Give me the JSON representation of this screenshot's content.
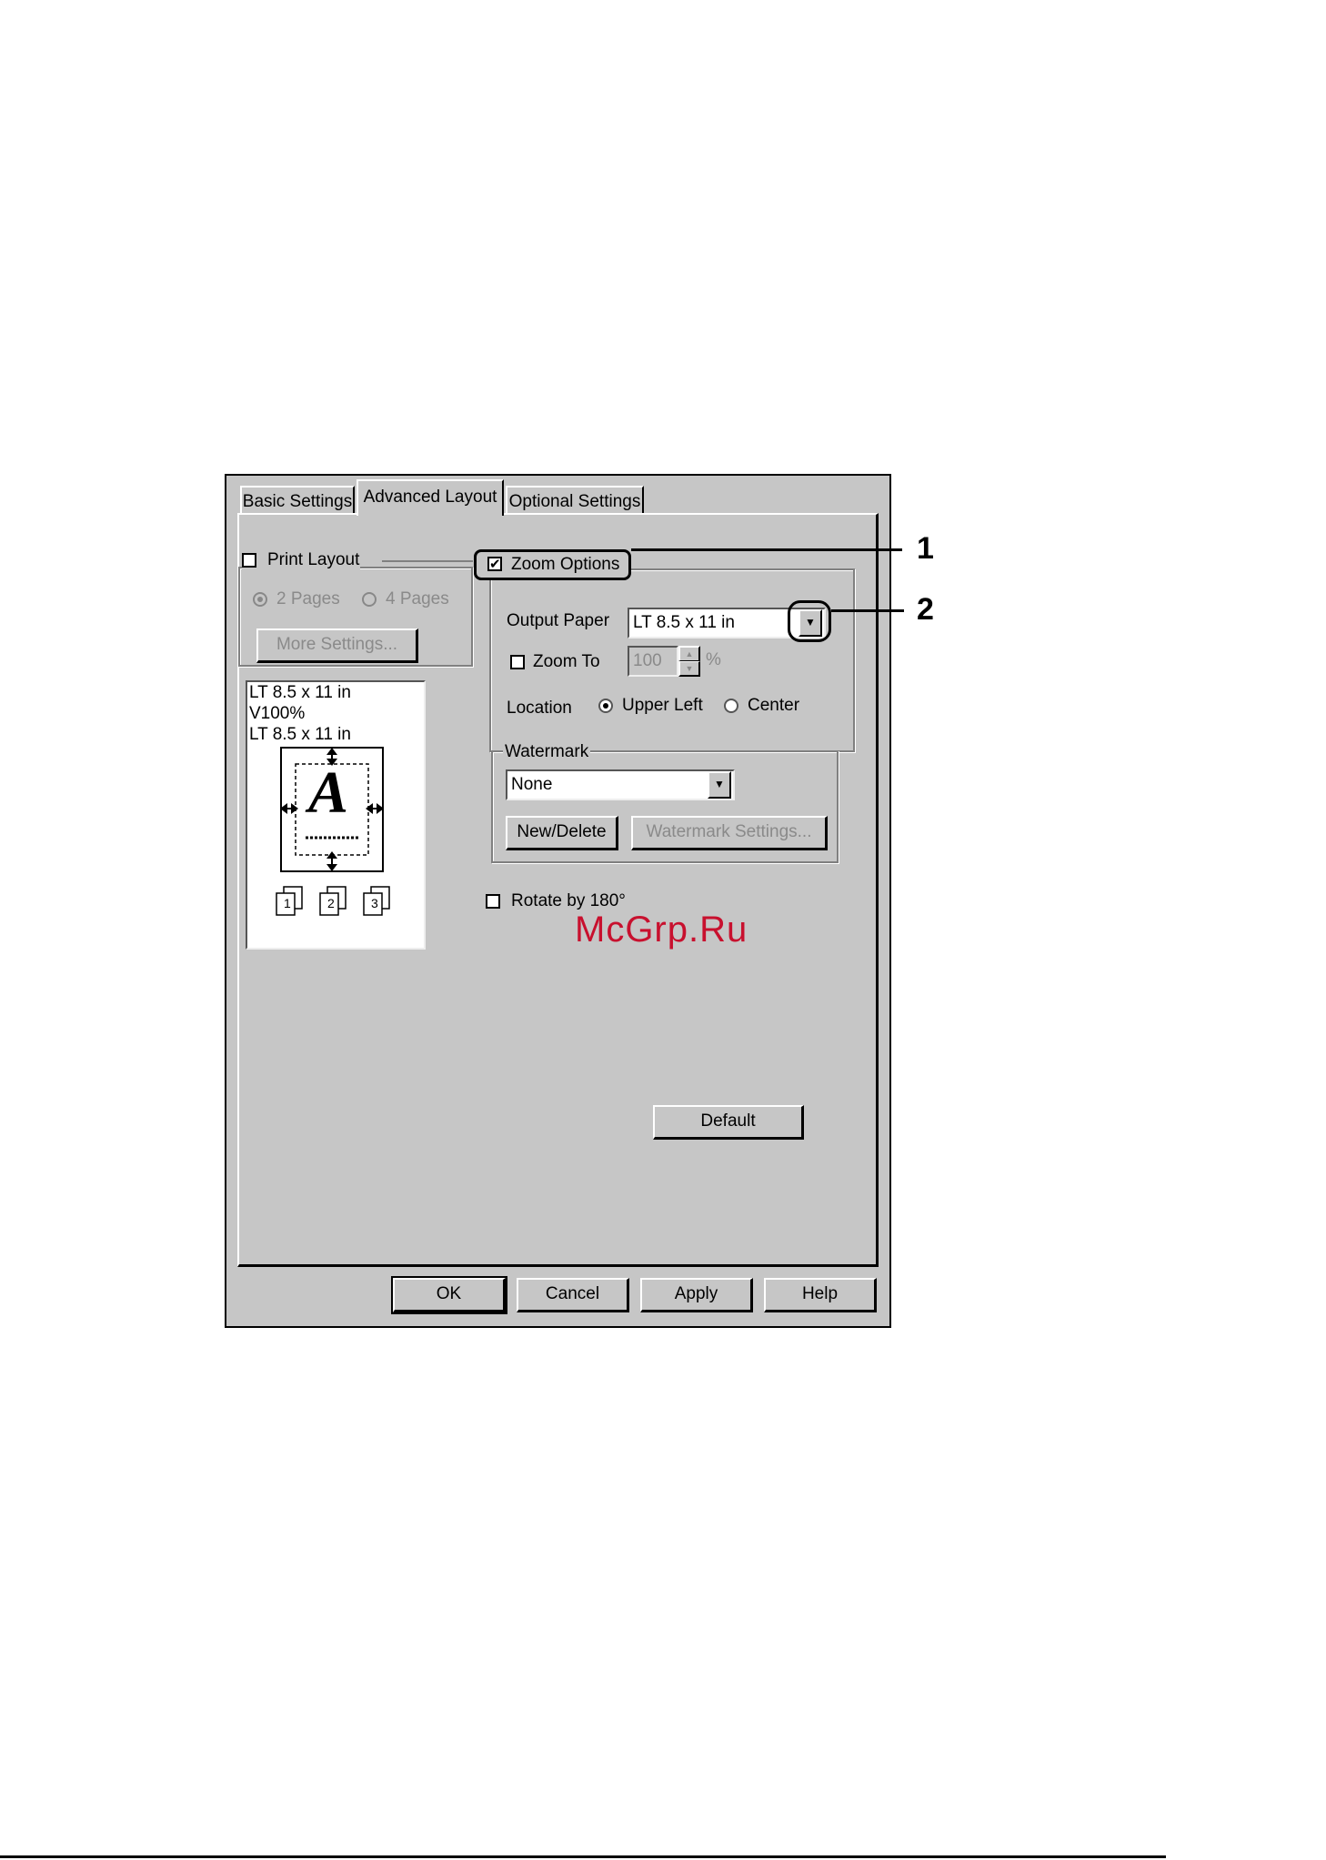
{
  "tabs": [
    {
      "label": "Basic Settings"
    },
    {
      "label": "Advanced Layout"
    },
    {
      "label": "Optional Settings"
    }
  ],
  "print_layout": {
    "label": "Print Layout",
    "checked": false,
    "options": [
      "2 Pages",
      "4 Pages"
    ],
    "more_settings": "More Settings..."
  },
  "preview": {
    "lines": [
      "LT 8.5 x 11 in",
      "V100%",
      "LT 8.5 x 11 in"
    ],
    "letter": "A",
    "copies": [
      "1",
      "2",
      "3"
    ]
  },
  "zoom_options": {
    "label": "Zoom Options",
    "checked": true,
    "output_paper_label": "Output Paper",
    "output_paper_value": "LT 8.5 x 11 in",
    "zoom_to_label": "Zoom To",
    "zoom_to_value": "100",
    "zoom_unit": "%",
    "location_label": "Location",
    "location_options": [
      "Upper Left",
      "Center"
    ],
    "location_selected": "Upper Left"
  },
  "watermark": {
    "label": "Watermark",
    "value": "None",
    "new_delete": "New/Delete",
    "settings": "Watermark Settings..."
  },
  "rotate": {
    "label": "Rotate by 180°",
    "checked": false
  },
  "buttons": {
    "default": "Default",
    "ok": "OK",
    "cancel": "Cancel",
    "apply": "Apply",
    "help": "Help"
  },
  "callouts": {
    "one": "1",
    "two": "2"
  },
  "watermark_site": "McGrp.Ru"
}
